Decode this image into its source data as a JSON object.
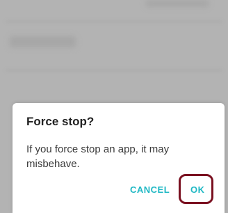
{
  "dialog": {
    "title": "Force stop?",
    "message": "If you force stop an app, it may misbehave.",
    "cancel_label": "CANCEL",
    "ok_label": "OK"
  },
  "colors": {
    "accent": "#1fb8c4",
    "highlight_ring": "#7a1020",
    "scrim": "#b3b3b3",
    "dialog_background": "#ffffff"
  }
}
